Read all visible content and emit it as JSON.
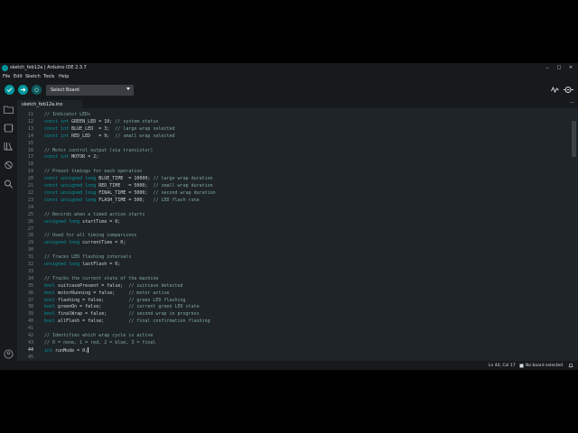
{
  "window": {
    "title": "sketch_feb12a | Arduino IDE 2.3.7",
    "minimize": "–",
    "maximize": "□",
    "close": "✕"
  },
  "menu": [
    "File",
    "Edit",
    "Sketch",
    "Tools",
    "Help"
  ],
  "toolbar": {
    "board_select": "Select Board"
  },
  "tab": {
    "name": "sketch_feb12a.ino",
    "more": "···"
  },
  "editor": {
    "lines": [
      {
        "n": "11",
        "t": "// Indicator LEDs"
      },
      {
        "n": "12",
        "t": "const int GREEN_LED = 10; // system status"
      },
      {
        "n": "13",
        "t": "const int BLUE_LED  = 3;  // large wrap selected"
      },
      {
        "n": "14",
        "t": "const int RED_LED   = 9;  // small wrap selected"
      },
      {
        "n": "15",
        "t": ""
      },
      {
        "n": "16",
        "t": "// Motor control output (via transistor)"
      },
      {
        "n": "17",
        "t": "const int MOTOR = 2;"
      },
      {
        "n": "18",
        "t": ""
      },
      {
        "n": "19",
        "t": "// Preset timings for each operation"
      },
      {
        "n": "20",
        "t": "const unsigned long BLUE_TIME  = 10000; // large wrap duration"
      },
      {
        "n": "21",
        "t": "const unsigned long RED_TIME   = 5000;  // small wrap duration"
      },
      {
        "n": "22",
        "t": "const unsigned long FINAL_TIME = 5000;  // second wrap duration"
      },
      {
        "n": "23",
        "t": "const unsigned long FLASH_TIME = 500;   // LED flash rate"
      },
      {
        "n": "24",
        "t": ""
      },
      {
        "n": "25",
        "t": "// Records when a timed action starts"
      },
      {
        "n": "26",
        "t": "unsigned long startTime = 0;"
      },
      {
        "n": "27",
        "t": ""
      },
      {
        "n": "28",
        "t": "// Used for all timing comparisons"
      },
      {
        "n": "29",
        "t": "unsigned long currentTime = 0;"
      },
      {
        "n": "30",
        "t": ""
      },
      {
        "n": "31",
        "t": "// Tracks LED flashing intervals"
      },
      {
        "n": "32",
        "t": "unsigned long lastFlash = 0;"
      },
      {
        "n": "33",
        "t": ""
      },
      {
        "n": "34",
        "t": "// Tracks the current state of the machine"
      },
      {
        "n": "35",
        "t": "bool suitcasePresent = false;  // suitcase detected"
      },
      {
        "n": "36",
        "t": "bool motorRunning = false;     // motor active"
      },
      {
        "n": "37",
        "t": "bool flashing = false;         // green LED flashing"
      },
      {
        "n": "38",
        "t": "bool greenOn = false;          // current green LED state"
      },
      {
        "n": "39",
        "t": "bool finalWrap = false;        // second wrap in progress"
      },
      {
        "n": "40",
        "t": "bool allFlash = false;         // final confirmation flashing"
      },
      {
        "n": "41",
        "t": ""
      },
      {
        "n": "42",
        "t": "// Identifies which wrap cycle is active"
      },
      {
        "n": "43",
        "t": "// 0 = none, 1 = red, 2 = blue, 3 = final"
      },
      {
        "n": "44",
        "t": "int runMode = 0;"
      },
      {
        "n": "45",
        "t": ""
      }
    ],
    "current_line": "44"
  },
  "status": {
    "position": "Ln 44, Col 17",
    "board": "No board selected"
  },
  "colors": {
    "accent": "#00979d",
    "background": "#1f2428",
    "chrome": "#171a1d",
    "comment": "#7fa5a6"
  }
}
